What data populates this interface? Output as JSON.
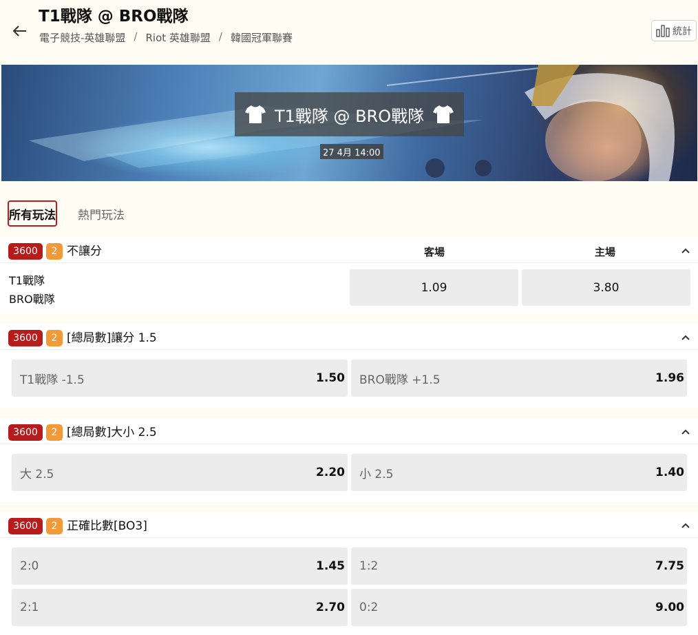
{
  "header": {
    "title": "T1戰隊 @ BRO戰隊",
    "breadcrumb": [
      "電子競技-英雄聯盟",
      "Riot 英雄聯盟",
      "韓國冠軍聯賽"
    ],
    "stats_label": "統計"
  },
  "banner": {
    "title": "T1戰隊 @ BRO戰隊",
    "time": "27 4月 14:00"
  },
  "tabs": [
    {
      "label": "所有玩法",
      "active": true
    },
    {
      "label": "熱門玩法",
      "active": false
    }
  ],
  "markets": [
    {
      "id": "3600",
      "count": "2",
      "name": "不讓分",
      "columns": [
        "客場",
        "主場"
      ],
      "teams": [
        "T1戰隊",
        "BRO戰隊"
      ],
      "odds": [
        "1.09",
        "3.80"
      ]
    },
    {
      "id": "3600",
      "count": "2",
      "name": "[總局數]讓分 1.5",
      "selections": [
        {
          "label": "T1戰隊 -1.5",
          "price": "1.50"
        },
        {
          "label": "BRO戰隊 +1.5",
          "price": "1.96"
        }
      ]
    },
    {
      "id": "3600",
      "count": "2",
      "name": "[總局數]大小 2.5",
      "selections": [
        {
          "label": "大 2.5",
          "price": "2.20"
        },
        {
          "label": "小 2.5",
          "price": "1.40"
        }
      ]
    },
    {
      "id": "3600",
      "count": "2",
      "name": "正確比數[BO3]",
      "selections": [
        {
          "label": "2:0",
          "price": "1.45"
        },
        {
          "label": "1:2",
          "price": "7.75"
        },
        {
          "label": "2:1",
          "price": "2.70"
        },
        {
          "label": "0:2",
          "price": "9.00"
        }
      ]
    }
  ],
  "colors": {
    "badge_red": "#b71c1c",
    "badge_orange": "#f29a3a",
    "background": "#fefcf3",
    "odd_button": "#ececec"
  }
}
